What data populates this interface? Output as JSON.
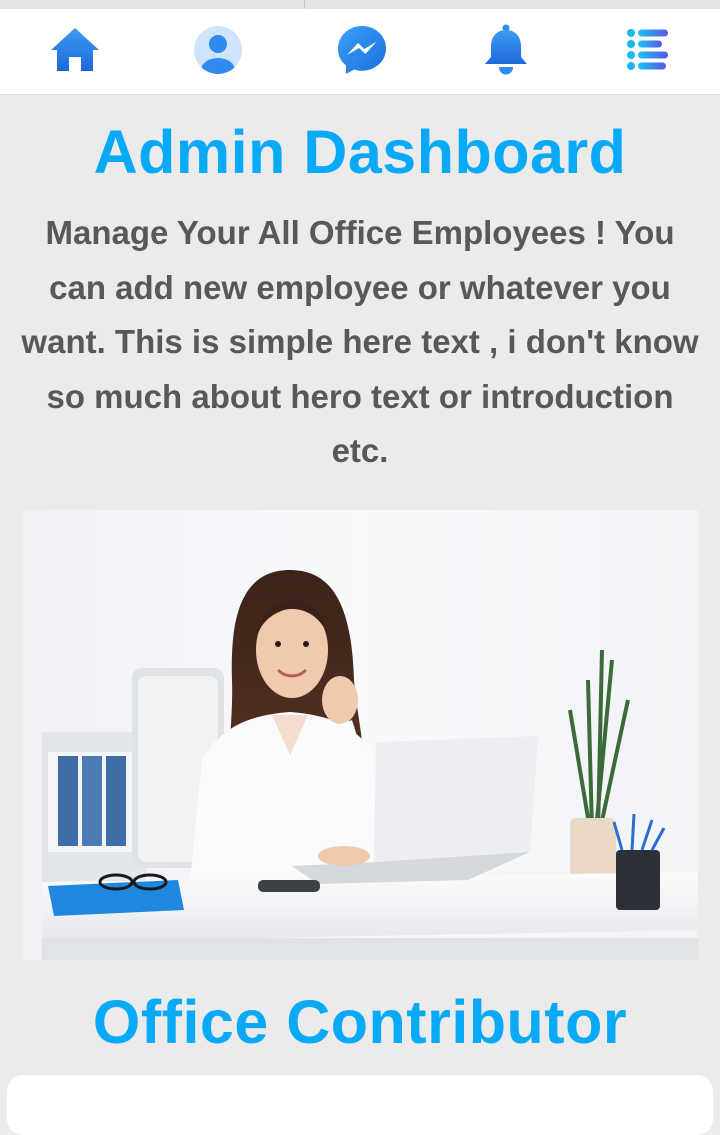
{
  "colors": {
    "accent": "#08a9f6",
    "nav_icon": "#2f8bee",
    "body_text": "#585858",
    "background": "#ebebeb"
  },
  "nav": {
    "items": [
      {
        "icon": "home-icon"
      },
      {
        "icon": "profile-icon"
      },
      {
        "icon": "messenger-icon"
      },
      {
        "icon": "bell-icon"
      },
      {
        "icon": "menu-icon"
      }
    ]
  },
  "header": {
    "title": "Admin Dashboard",
    "intro": "Manage Your All Office Employees ! You can add new employee or whatever you want. This is simple here text , i don't know so much about hero text or introduction etc."
  },
  "hero": {
    "image": "office-woman-laptop-photo"
  },
  "section": {
    "title": "Office Contributor"
  }
}
